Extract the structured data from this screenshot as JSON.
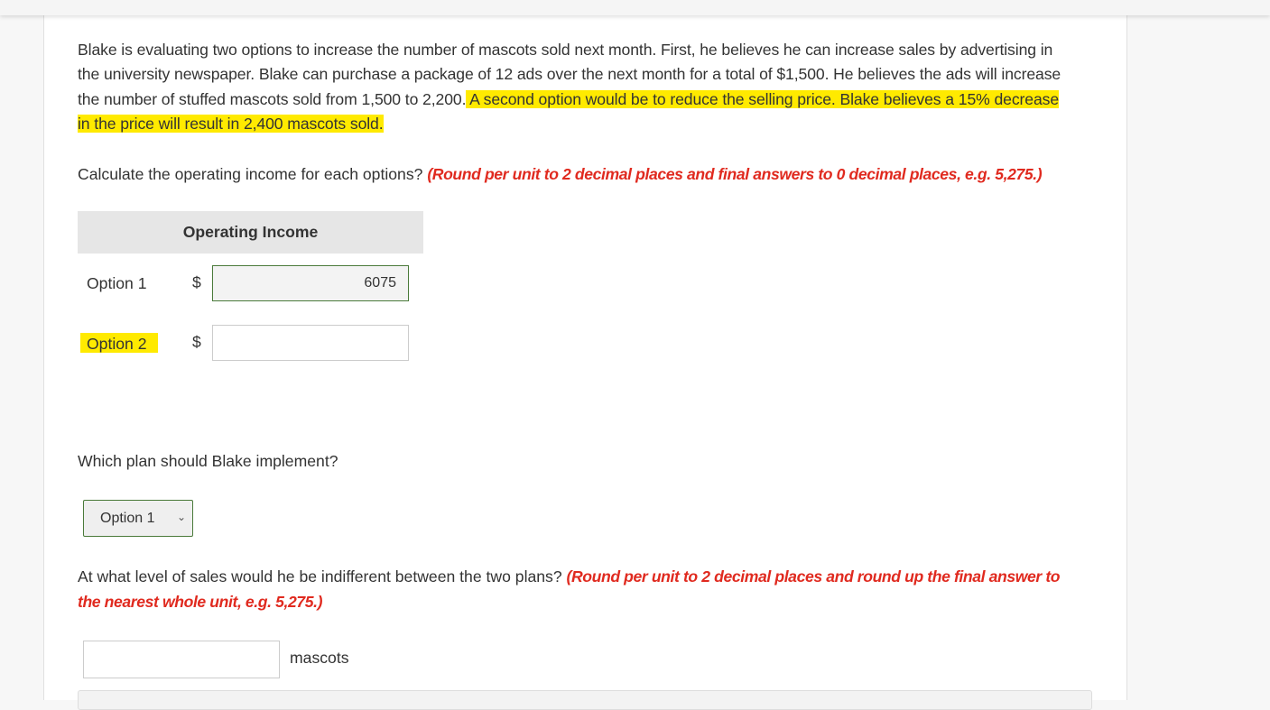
{
  "problem": {
    "text_plain": "Blake is evaluating two options to increase the number of mascots sold next month. First, he believes he can increase sales by advertising in the university newspaper. Blake can purchase a package of 12 ads over the next month for a total of $1,500. He believes the ads will increase the number of stuffed mascots sold from 1,500 to 2,200.",
    "text_highlighted": " A second option would be to reduce the selling price. Blake believes a 15% decrease in the price will result in 2,400 mascots sold."
  },
  "question1": {
    "text": "Calculate the operating income for each options?",
    "instruction": "(Round per unit to 2 decimal places and final answers to 0 decimal places, e.g. 5,275.)"
  },
  "table": {
    "header": "Operating Income",
    "rows": [
      {
        "label": "Option 1",
        "currency": "$",
        "value": "6075",
        "highlighted": false
      },
      {
        "label": "Option 2",
        "currency": "$",
        "value": "",
        "highlighted": true
      }
    ]
  },
  "question2": {
    "text": "Which plan should Blake implement?",
    "selected": "Option 1"
  },
  "question3": {
    "text": "At what level of sales would he be indifferent between the two plans?",
    "instruction": "(Round per unit to 2 decimal places and round up the final answer to the nearest whole unit, e.g. 5,275.)",
    "value": "",
    "unit": "mascots"
  },
  "colors": {
    "highlight": "#ffea00",
    "instruction": "#e02a1f",
    "filled_border": "#4a7a3a"
  }
}
